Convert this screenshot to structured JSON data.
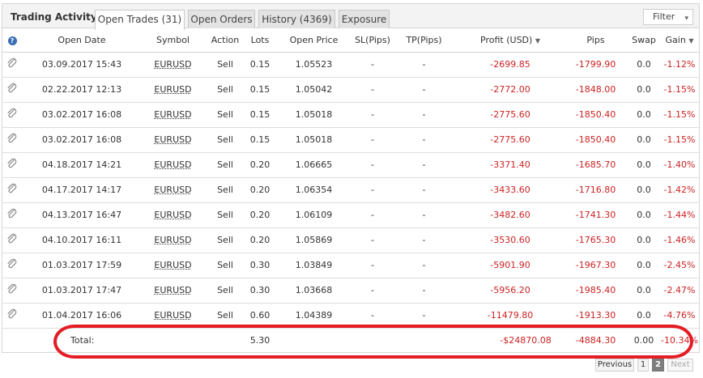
{
  "header": {
    "title": "Trading Activity",
    "tabs": [
      {
        "label": "Open Trades (31)",
        "active": true
      },
      {
        "label": "Open Orders",
        "active": false
      },
      {
        "label": "History (4369)",
        "active": false
      },
      {
        "label": "Exposure",
        "active": false
      }
    ],
    "filter_label": "Filter",
    "filter_icon": "chevron-down-icon"
  },
  "columns": [
    "Open Date",
    "Symbol",
    "Action",
    "Lots",
    "Open Price",
    "SL(Pips)",
    "TP(Pips)",
    "Profit (USD)",
    "Pips",
    "Swap",
    "Gain"
  ],
  "column_icons": {
    "info": "help-icon",
    "sorted_profit": "sort-desc-icon",
    "sorted_gain": "sort-desc-icon"
  },
  "row_icon": "paperclip-icon",
  "rows": [
    {
      "date": "03.09.2017 15:43",
      "symbol": "EURUSD",
      "action": "Sell",
      "lots": "0.15",
      "price": "1.05523",
      "sl": "-",
      "tp": "-",
      "profit": "-2699.85",
      "pips": "-1799.90",
      "swap": "0.0",
      "gain": "-1.12%"
    },
    {
      "date": "02.22.2017 12:13",
      "symbol": "EURUSD",
      "action": "Sell",
      "lots": "0.15",
      "price": "1.05042",
      "sl": "-",
      "tp": "-",
      "profit": "-2772.00",
      "pips": "-1848.00",
      "swap": "0.0",
      "gain": "-1.15%"
    },
    {
      "date": "03.02.2017 16:08",
      "symbol": "EURUSD",
      "action": "Sell",
      "lots": "0.15",
      "price": "1.05018",
      "sl": "-",
      "tp": "-",
      "profit": "-2775.60",
      "pips": "-1850.40",
      "swap": "0.0",
      "gain": "-1.15%"
    },
    {
      "date": "03.02.2017 16:08",
      "symbol": "EURUSD",
      "action": "Sell",
      "lots": "0.15",
      "price": "1.05018",
      "sl": "-",
      "tp": "-",
      "profit": "-2775.60",
      "pips": "-1850.40",
      "swap": "0.0",
      "gain": "-1.15%"
    },
    {
      "date": "04.18.2017 14:21",
      "symbol": "EURUSD",
      "action": "Sell",
      "lots": "0.20",
      "price": "1.06665",
      "sl": "-",
      "tp": "-",
      "profit": "-3371.40",
      "pips": "-1685.70",
      "swap": "0.0",
      "gain": "-1.40%"
    },
    {
      "date": "04.17.2017 14:17",
      "symbol": "EURUSD",
      "action": "Sell",
      "lots": "0.20",
      "price": "1.06354",
      "sl": "-",
      "tp": "-",
      "profit": "-3433.60",
      "pips": "-1716.80",
      "swap": "0.0",
      "gain": "-1.42%"
    },
    {
      "date": "04.13.2017 16:47",
      "symbol": "EURUSD",
      "action": "Sell",
      "lots": "0.20",
      "price": "1.06109",
      "sl": "-",
      "tp": "-",
      "profit": "-3482.60",
      "pips": "-1741.30",
      "swap": "0.0",
      "gain": "-1.44%"
    },
    {
      "date": "04.10.2017 16:11",
      "symbol": "EURUSD",
      "action": "Sell",
      "lots": "0.20",
      "price": "1.05869",
      "sl": "-",
      "tp": "-",
      "profit": "-3530.60",
      "pips": "-1765.30",
      "swap": "0.0",
      "gain": "-1.46%"
    },
    {
      "date": "01.03.2017 17:59",
      "symbol": "EURUSD",
      "action": "Sell",
      "lots": "0.30",
      "price": "1.03849",
      "sl": "-",
      "tp": "-",
      "profit": "-5901.90",
      "pips": "-1967.30",
      "swap": "0.0",
      "gain": "-2.45%"
    },
    {
      "date": "01.03.2017 17:47",
      "symbol": "EURUSD",
      "action": "Sell",
      "lots": "0.30",
      "price": "1.03668",
      "sl": "-",
      "tp": "-",
      "profit": "-5956.20",
      "pips": "-1985.40",
      "swap": "0.0",
      "gain": "-2.47%"
    },
    {
      "date": "01.04.2017 16:06",
      "symbol": "EURUSD",
      "action": "Sell",
      "lots": "0.60",
      "price": "1.04389",
      "sl": "-",
      "tp": "-",
      "profit": "-11479.80",
      "pips": "-1913.30",
      "swap": "0.0",
      "gain": "-4.76%"
    }
  ],
  "total": {
    "label": "Total:",
    "lots": "5.30",
    "profit": "-$24870.08",
    "pips": "-4884.30",
    "swap": "0.00",
    "gain": "-10.34%"
  },
  "pagination": {
    "previous": "Previous",
    "pages": [
      "1",
      "2"
    ],
    "current": "2",
    "next": "Next"
  },
  "colors": {
    "negative": "#cc2222",
    "highlight": "#e41c24",
    "header_bg": "#f3f3f3"
  }
}
